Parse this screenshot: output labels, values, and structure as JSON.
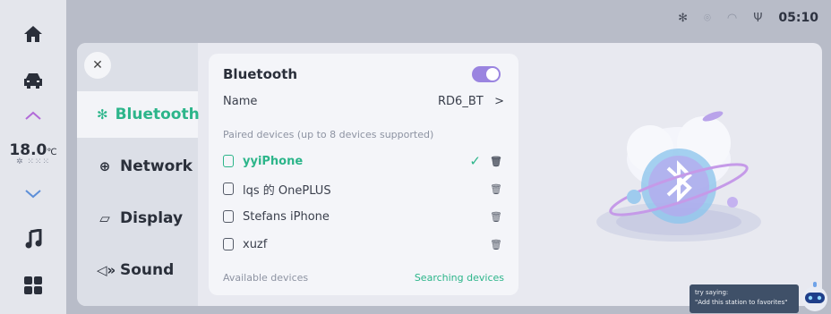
{
  "status_bar": {
    "icons": [
      "bluetooth-icon",
      "hotspot-icon",
      "wifi-icon",
      "usb-icon"
    ],
    "time": "05:10"
  },
  "rail": {
    "items": [
      "home-icon",
      "car-icon",
      "chevron-up-icon",
      "chevron-down-icon",
      "music-icon",
      "apps-icon"
    ],
    "temperature": "18.0",
    "temperature_unit": "℃",
    "fan_glyph": "✲ ⁙⁙⁙"
  },
  "menu": {
    "close_glyph": "✕",
    "items": [
      {
        "label": "Bluetooth",
        "icon": "bluetooth-icon",
        "glyph": "✻",
        "active": true
      },
      {
        "label": "Network",
        "icon": "globe-icon",
        "glyph": "⊕",
        "active": false
      },
      {
        "label": "Display",
        "icon": "display-icon",
        "glyph": "▱",
        "active": false
      },
      {
        "label": "Sound",
        "icon": "speaker-icon",
        "glyph": "◁»",
        "active": false
      }
    ]
  },
  "bluetooth": {
    "title": "Bluetooth",
    "enabled": true,
    "name_label": "Name",
    "name_value": "RD6_BT",
    "chevron": ">",
    "paired_header": "Paired devices (up to 8 devices supported)",
    "paired_devices": [
      {
        "name": "yyiPhone",
        "connected": true
      },
      {
        "name": "lqs 的 OnePLUS",
        "connected": false
      },
      {
        "name": "Stefans iPhone",
        "connected": false
      },
      {
        "name": "xuzf",
        "connected": false
      }
    ],
    "check_glyph": "✓",
    "delete_glyph": "🗑",
    "available_label": "Available devices",
    "searching_label": "Searching devices"
  },
  "voice_tip": {
    "line1": "try saying:",
    "line2": "\"Add this station to favorites\""
  },
  "colors": {
    "accent": "#2cb58a",
    "toggle": "#9a84e0",
    "panel": "#e8e9f0"
  }
}
